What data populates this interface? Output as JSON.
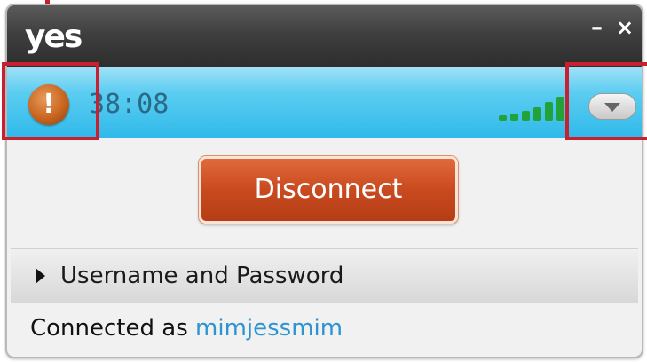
{
  "window": {
    "logo": "yes",
    "minimize_glyph": "–",
    "close_glyph": "×"
  },
  "status": {
    "alert_glyph": "!",
    "timer": "38:08",
    "signal_level_bars": 6,
    "signal_color": "#22a33a"
  },
  "actions": {
    "disconnect_label": "Disconnect",
    "disconnect_color": "#c94a1f"
  },
  "credentials": {
    "expander_label": "Username and Password"
  },
  "footer": {
    "connected_prefix": "Connected as",
    "username": "mimjessmim",
    "username_color": "#2d93d1"
  },
  "colors": {
    "titlebar": "#3f3f3f",
    "statusbar": "#5ccdf1",
    "annotation": "#c8202f"
  }
}
